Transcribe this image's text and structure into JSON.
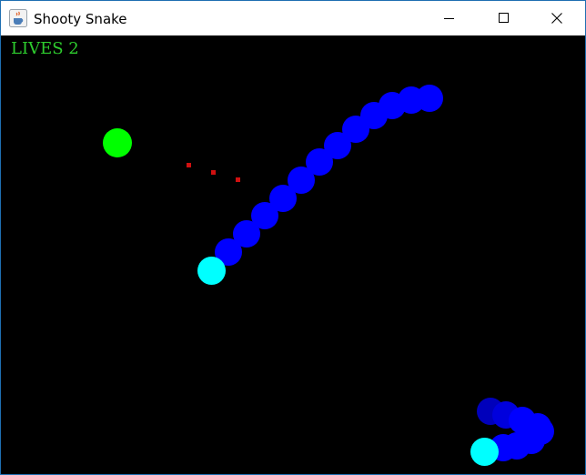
{
  "window": {
    "title": "Shooty Snake",
    "controls": [
      "minimize",
      "maximize",
      "close"
    ],
    "icon": "java-cup-icon"
  },
  "hud": {
    "lives_label": "LIVES",
    "lives_value": "2",
    "text_color": "#2ecc2e"
  },
  "game": {
    "background_color": "#000000",
    "food_color": "#00ff00",
    "snake_body_color": "#0000ff",
    "snake_head_color": "#00ffff",
    "bullet_color": "#d01010",
    "food_count": 1,
    "bullet_count": 3,
    "snake_count": 2
  }
}
